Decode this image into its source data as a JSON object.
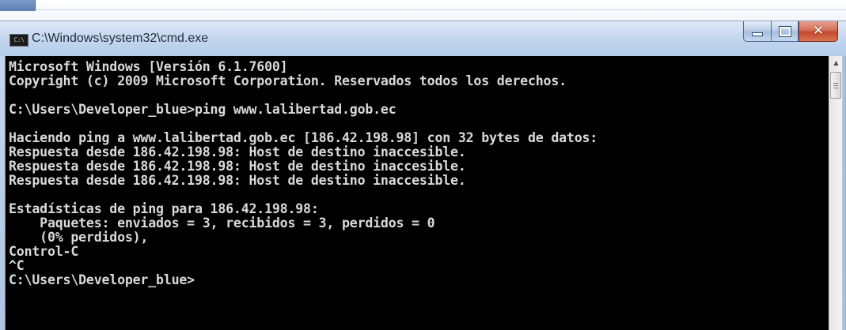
{
  "window": {
    "title": "C:\\Windows\\system32\\cmd.exe",
    "icon_text": "C:\\",
    "icon": "cmd-icon"
  },
  "caption_buttons": {
    "minimize": "minimize-icon",
    "maximize": "maximize-icon",
    "close": "close-icon",
    "close_glyph": "✕"
  },
  "console": {
    "lines": [
      "Microsoft Windows [Versión 6.1.7600]",
      "Copyright (c) 2009 Microsoft Corporation. Reservados todos los derechos.",
      "",
      "C:\\Users\\Developer_blue>ping www.lalibertad.gob.ec",
      "",
      "Haciendo ping a www.lalibertad.gob.ec [186.42.198.98] con 32 bytes de datos:",
      "Respuesta desde 186.42.198.98: Host de destino inaccesible.",
      "Respuesta desde 186.42.198.98: Host de destino inaccesible.",
      "Respuesta desde 186.42.198.98: Host de destino inaccesible.",
      "",
      "Estadísticas de ping para 186.42.198.98:",
      "    Paquetes: enviados = 3, recibidos = 3, perdidos = 0",
      "    (0% perdidos),",
      "Control-C",
      "^C",
      "C:\\Users\\Developer_blue>"
    ],
    "text_color": "#d9d9d9",
    "background": "#000000"
  },
  "scrollbar": {
    "up_glyph": "▲"
  }
}
